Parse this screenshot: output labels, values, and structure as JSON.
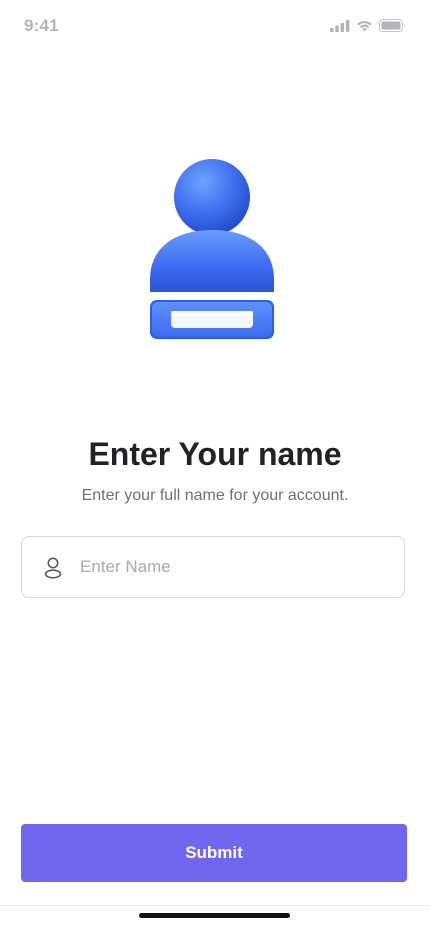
{
  "status_bar": {
    "time": "9:41",
    "icons": [
      "cellular-signal-icon",
      "wifi-icon",
      "battery-icon"
    ]
  },
  "illustration": {
    "icon": "user-profile-icon",
    "accent_color": "#3f6ff0"
  },
  "header": {
    "title": "Enter Your name",
    "subtitle": "Enter your full name for your account."
  },
  "name_input": {
    "icon": "person-icon",
    "placeholder": "Enter Name",
    "value": ""
  },
  "submit": {
    "label": "Submit",
    "color": "#7166ee"
  }
}
